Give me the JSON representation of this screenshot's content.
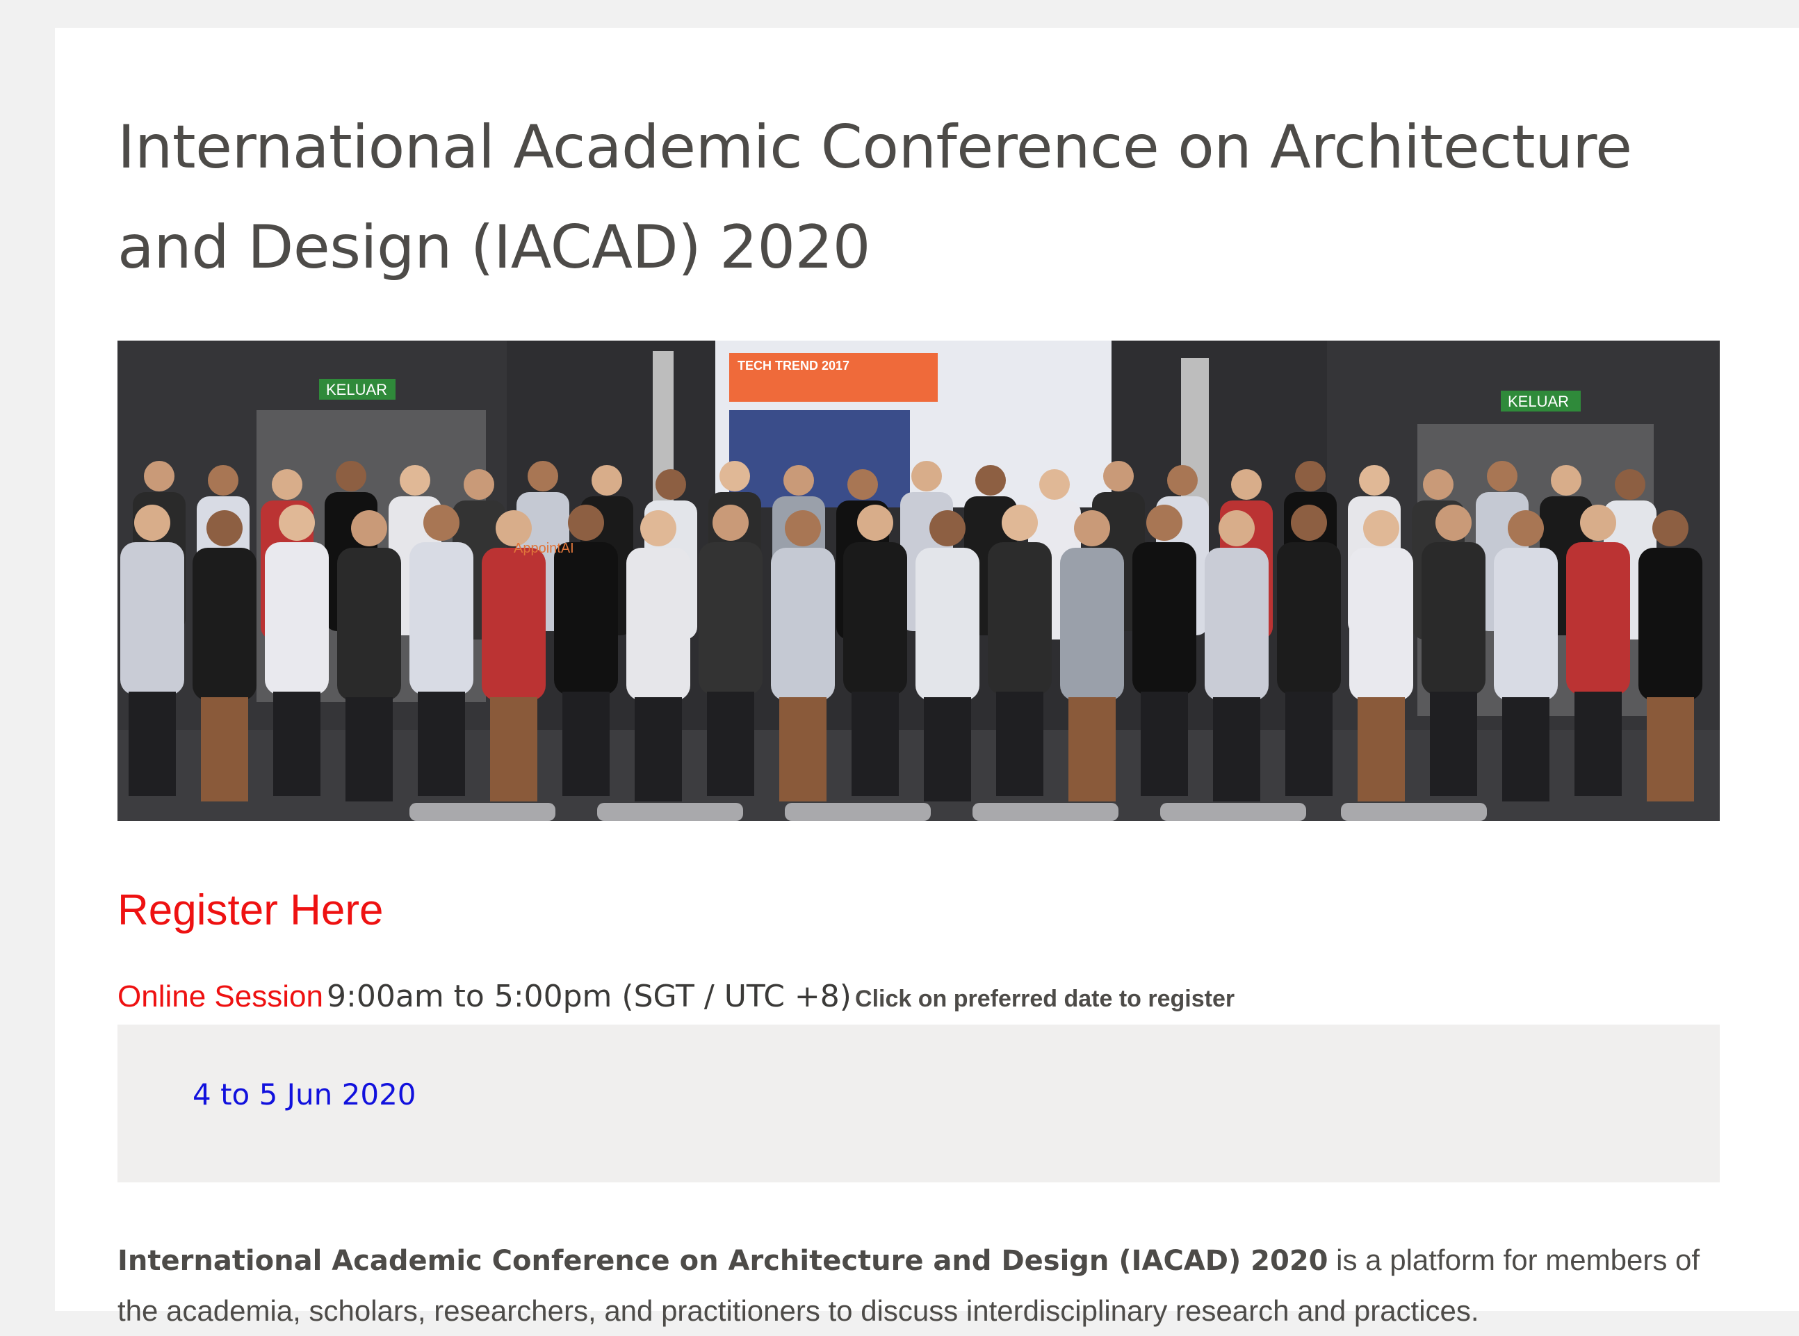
{
  "page": {
    "title": "International Academic Conference on Architecture and Design (IACAD) 2020"
  },
  "photo": {
    "description_icon": "group-photo",
    "projector_text": "TECH TREND 2017",
    "exit_sign_left": "KELUAR",
    "exit_sign_right": "KELUAR",
    "shirt_text": "AppointAI"
  },
  "register": {
    "label": "Register Here"
  },
  "session": {
    "label": "Online Session",
    "time": "9:00am to 5:00pm (SGT / UTC +8)",
    "hint": "Click on preferred date to register"
  },
  "dates": [
    {
      "label": "4 to 5 Jun 2020"
    }
  ],
  "description": {
    "bold": "International Academic Conference on Architecture and Design (IACAD) 2020",
    "rest": " is a platform for members of the academia, scholars, researchers, and practitioners to discuss interdisciplinary research and practices."
  },
  "colors": {
    "accent_red": "#ee1111",
    "link_blue": "#1111dd",
    "text": "#4d4b48",
    "box_bg": "#f0efee",
    "page_bg": "#f1f1f1"
  }
}
